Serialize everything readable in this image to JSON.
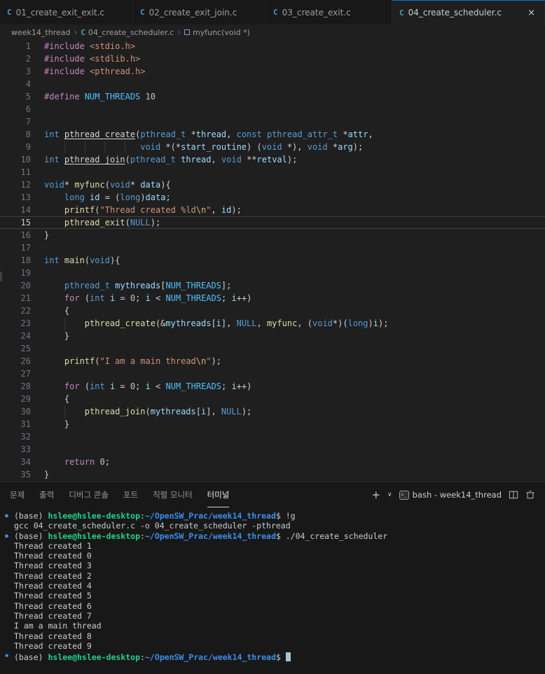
{
  "tabs": [
    {
      "label": "01_create_exit_exit.c",
      "active": false
    },
    {
      "label": "02_create_exit_join.c",
      "active": false
    },
    {
      "label": "03_create_exit.c",
      "active": false
    },
    {
      "label": "04_create_scheduler.c",
      "active": true
    }
  ],
  "tab_close_glyph": "×",
  "breadcrumb": {
    "root": "week14_thread",
    "file": "04_create_scheduler.c",
    "symbol": "myfunc(void *)",
    "separator": "›"
  },
  "editor": {
    "current_line": 15,
    "lines": [
      {
        "num": 1,
        "tokens": [
          [
            "kw",
            "#include"
          ],
          [
            "pl",
            " "
          ],
          [
            "str",
            "<stdio.h>"
          ]
        ]
      },
      {
        "num": 2,
        "tokens": [
          [
            "kw",
            "#include"
          ],
          [
            "pl",
            " "
          ],
          [
            "str",
            "<stdlib.h>"
          ]
        ]
      },
      {
        "num": 3,
        "tokens": [
          [
            "kw",
            "#include"
          ],
          [
            "pl",
            " "
          ],
          [
            "str",
            "<pthread.h>"
          ]
        ]
      },
      {
        "num": 4,
        "tokens": []
      },
      {
        "num": 5,
        "tokens": [
          [
            "kw",
            "#define"
          ],
          [
            "pl",
            " "
          ],
          [
            "mac",
            "NUM_THREADS"
          ],
          [
            "pl",
            " "
          ],
          [
            "num",
            "10"
          ]
        ]
      },
      {
        "num": 6,
        "tokens": []
      },
      {
        "num": 7,
        "tokens": []
      },
      {
        "num": 8,
        "tokens": [
          [
            "ty",
            "int"
          ],
          [
            "pl",
            " "
          ],
          [
            "fnu",
            "pthread_create"
          ],
          [
            "pl",
            "("
          ],
          [
            "ty",
            "pthread_t"
          ],
          [
            "pl",
            " *"
          ],
          [
            "var",
            "thread"
          ],
          [
            "pl",
            ", "
          ],
          [
            "ty",
            "const"
          ],
          [
            "pl",
            " "
          ],
          [
            "ty",
            "pthread_attr_t"
          ],
          [
            "pl",
            " *"
          ],
          [
            "var",
            "attr"
          ],
          [
            "pl",
            ","
          ]
        ]
      },
      {
        "num": 9,
        "guides": [
          4,
          8,
          12,
          16
        ],
        "tokens": [
          [
            "pl",
            "                   "
          ],
          [
            "ty",
            "void"
          ],
          [
            "pl",
            " *(*"
          ],
          [
            "var",
            "start_routine"
          ],
          [
            "pl",
            ") ("
          ],
          [
            "ty",
            "void"
          ],
          [
            "pl",
            " *), "
          ],
          [
            "ty",
            "void"
          ],
          [
            "pl",
            " *"
          ],
          [
            "var",
            "arg"
          ],
          [
            "pl",
            ");"
          ]
        ]
      },
      {
        "num": 10,
        "tokens": [
          [
            "ty",
            "int"
          ],
          [
            "pl",
            " "
          ],
          [
            "fnu",
            "pthread_join"
          ],
          [
            "pl",
            "("
          ],
          [
            "ty",
            "pthread_t"
          ],
          [
            "pl",
            " "
          ],
          [
            "var",
            "thread"
          ],
          [
            "pl",
            ", "
          ],
          [
            "ty",
            "void"
          ],
          [
            "pl",
            " **"
          ],
          [
            "var",
            "retval"
          ],
          [
            "pl",
            ");"
          ]
        ]
      },
      {
        "num": 11,
        "tokens": []
      },
      {
        "num": 12,
        "tokens": [
          [
            "ty",
            "void"
          ],
          [
            "pl",
            "* "
          ],
          [
            "fn",
            "myfunc"
          ],
          [
            "pl",
            "("
          ],
          [
            "ty",
            "void"
          ],
          [
            "pl",
            "* "
          ],
          [
            "var",
            "data"
          ],
          [
            "pl",
            "){"
          ]
        ]
      },
      {
        "num": 13,
        "tokens": [
          [
            "pl",
            "    "
          ],
          [
            "ty",
            "long"
          ],
          [
            "pl",
            " "
          ],
          [
            "var",
            "id"
          ],
          [
            "pl",
            " = ("
          ],
          [
            "ty",
            "long"
          ],
          [
            "pl",
            ")"
          ],
          [
            "var",
            "data"
          ],
          [
            "pl",
            ";"
          ]
        ]
      },
      {
        "num": 14,
        "tokens": [
          [
            "pl",
            "    "
          ],
          [
            "fn",
            "printf"
          ],
          [
            "pl",
            "("
          ],
          [
            "str",
            "\"Thread created %ld"
          ],
          [
            "esc",
            "\\n"
          ],
          [
            "str",
            "\""
          ],
          [
            "pl",
            ", "
          ],
          [
            "var",
            "id"
          ],
          [
            "pl",
            ");"
          ]
        ]
      },
      {
        "num": 15,
        "tokens": [
          [
            "pl",
            "    "
          ],
          [
            "fn",
            "pthread_exit"
          ],
          [
            "pl",
            "("
          ],
          [
            "ty",
            "NULL"
          ],
          [
            "pl",
            ");"
          ]
        ]
      },
      {
        "num": 16,
        "tokens": [
          [
            "pl",
            "}"
          ]
        ]
      },
      {
        "num": 17,
        "tokens": []
      },
      {
        "num": 18,
        "tokens": [
          [
            "ty",
            "int"
          ],
          [
            "pl",
            " "
          ],
          [
            "fn",
            "main"
          ],
          [
            "pl",
            "("
          ],
          [
            "ty",
            "void"
          ],
          [
            "pl",
            "){"
          ]
        ]
      },
      {
        "num": 19,
        "tokens": []
      },
      {
        "num": 20,
        "tokens": [
          [
            "pl",
            "    "
          ],
          [
            "ty",
            "pthread_t"
          ],
          [
            "pl",
            " "
          ],
          [
            "var",
            "mythreads"
          ],
          [
            "pl",
            "["
          ],
          [
            "mac",
            "NUM_THREADS"
          ],
          [
            "pl",
            "];"
          ]
        ]
      },
      {
        "num": 21,
        "tokens": [
          [
            "pl",
            "    "
          ],
          [
            "kw",
            "for"
          ],
          [
            "pl",
            " ("
          ],
          [
            "ty",
            "int"
          ],
          [
            "pl",
            " "
          ],
          [
            "var",
            "i"
          ],
          [
            "pl",
            " = "
          ],
          [
            "num",
            "0"
          ],
          [
            "pl",
            "; "
          ],
          [
            "var",
            "i"
          ],
          [
            "pl",
            " < "
          ],
          [
            "mac",
            "NUM_THREADS"
          ],
          [
            "pl",
            "; "
          ],
          [
            "var",
            "i"
          ],
          [
            "pl",
            "++)"
          ]
        ]
      },
      {
        "num": 22,
        "tokens": [
          [
            "pl",
            "    {"
          ]
        ]
      },
      {
        "num": 23,
        "guides": [
          4
        ],
        "tokens": [
          [
            "pl",
            "        "
          ],
          [
            "fn",
            "pthread_create"
          ],
          [
            "pl",
            "(&"
          ],
          [
            "var",
            "mythreads"
          ],
          [
            "pl",
            "["
          ],
          [
            "var",
            "i"
          ],
          [
            "pl",
            "], "
          ],
          [
            "ty",
            "NULL"
          ],
          [
            "pl",
            ", "
          ],
          [
            "fn",
            "myfunc"
          ],
          [
            "pl",
            ", ("
          ],
          [
            "ty",
            "void"
          ],
          [
            "pl",
            "*)("
          ],
          [
            "ty",
            "long"
          ],
          [
            "pl",
            ")"
          ],
          [
            "var",
            "i"
          ],
          [
            "pl",
            ");"
          ]
        ]
      },
      {
        "num": 24,
        "tokens": [
          [
            "pl",
            "    }"
          ]
        ]
      },
      {
        "num": 25,
        "tokens": []
      },
      {
        "num": 26,
        "tokens": [
          [
            "pl",
            "    "
          ],
          [
            "fn",
            "printf"
          ],
          [
            "pl",
            "("
          ],
          [
            "str",
            "\"I am a main thread"
          ],
          [
            "esc",
            "\\n"
          ],
          [
            "str",
            "\""
          ],
          [
            "pl",
            ");"
          ]
        ]
      },
      {
        "num": 27,
        "tokens": []
      },
      {
        "num": 28,
        "tokens": [
          [
            "pl",
            "    "
          ],
          [
            "kw",
            "for"
          ],
          [
            "pl",
            " ("
          ],
          [
            "ty",
            "int"
          ],
          [
            "pl",
            " "
          ],
          [
            "var",
            "i"
          ],
          [
            "pl",
            " = "
          ],
          [
            "num",
            "0"
          ],
          [
            "pl",
            "; "
          ],
          [
            "var",
            "i"
          ],
          [
            "pl",
            " < "
          ],
          [
            "mac",
            "NUM_THREADS"
          ],
          [
            "pl",
            "; "
          ],
          [
            "var",
            "i"
          ],
          [
            "pl",
            "++)"
          ]
        ]
      },
      {
        "num": 29,
        "tokens": [
          [
            "pl",
            "    {"
          ]
        ]
      },
      {
        "num": 30,
        "guides": [
          4
        ],
        "tokens": [
          [
            "pl",
            "        "
          ],
          [
            "fn",
            "pthread_join"
          ],
          [
            "pl",
            "("
          ],
          [
            "var",
            "mythreads"
          ],
          [
            "pl",
            "["
          ],
          [
            "var",
            "i"
          ],
          [
            "pl",
            "], "
          ],
          [
            "ty",
            "NULL"
          ],
          [
            "pl",
            ");"
          ]
        ]
      },
      {
        "num": 31,
        "tokens": [
          [
            "pl",
            "    }"
          ]
        ]
      },
      {
        "num": 32,
        "tokens": []
      },
      {
        "num": 33,
        "tokens": []
      },
      {
        "num": 34,
        "tokens": [
          [
            "pl",
            "    "
          ],
          [
            "kw",
            "return"
          ],
          [
            "pl",
            " "
          ],
          [
            "num",
            "0"
          ],
          [
            "pl",
            ";"
          ]
        ]
      },
      {
        "num": 35,
        "tokens": [
          [
            "pl",
            "}"
          ]
        ]
      }
    ]
  },
  "panel": {
    "tabs": [
      {
        "label": "문제",
        "active": false
      },
      {
        "label": "출력",
        "active": false
      },
      {
        "label": "디버그 콘솔",
        "active": false
      },
      {
        "label": "포트",
        "active": false
      },
      {
        "label": "직렬 모니터",
        "active": false
      },
      {
        "label": "터미널",
        "active": true
      }
    ],
    "plus_glyph": "+",
    "chevron_glyph": "∨",
    "terminal_session_label": "bash - week14_thread"
  },
  "terminal": {
    "lines": [
      {
        "g": "●",
        "t": [
          [
            "pl",
            "(base) "
          ],
          [
            "user",
            "hslee@hslee-desktop"
          ],
          [
            "pl",
            ":"
          ],
          [
            "path",
            "~/OpenSW_Prac/week14_thread"
          ],
          [
            "pl",
            "$ !g"
          ]
        ]
      },
      {
        "g": "",
        "t": [
          [
            "pl",
            "gcc 04_create_scheduler.c -o 04_create_scheduler -pthread"
          ]
        ]
      },
      {
        "g": "●",
        "t": [
          [
            "pl",
            "(base) "
          ],
          [
            "user",
            "hslee@hslee-desktop"
          ],
          [
            "pl",
            ":"
          ],
          [
            "path",
            "~/OpenSW_Prac/week14_thread"
          ],
          [
            "pl",
            "$ ./04_create_scheduler"
          ]
        ]
      },
      {
        "g": "",
        "t": [
          [
            "pl",
            "Thread created 1"
          ]
        ]
      },
      {
        "g": "",
        "t": [
          [
            "pl",
            "Thread created 0"
          ]
        ]
      },
      {
        "g": "",
        "t": [
          [
            "pl",
            "Thread created 3"
          ]
        ]
      },
      {
        "g": "",
        "t": [
          [
            "pl",
            "Thread created 2"
          ]
        ]
      },
      {
        "g": "",
        "t": [
          [
            "pl",
            "Thread created 4"
          ]
        ]
      },
      {
        "g": "",
        "t": [
          [
            "pl",
            "Thread created 5"
          ]
        ]
      },
      {
        "g": "",
        "t": [
          [
            "pl",
            "Thread created 6"
          ]
        ]
      },
      {
        "g": "",
        "t": [
          [
            "pl",
            "Thread created 7"
          ]
        ]
      },
      {
        "g": "",
        "t": [
          [
            "pl",
            "I am a main thread"
          ]
        ]
      },
      {
        "g": "",
        "t": [
          [
            "pl",
            "Thread created 8"
          ]
        ]
      },
      {
        "g": "",
        "t": [
          [
            "pl",
            "Thread created 9"
          ]
        ]
      },
      {
        "g": "◆",
        "t": [
          [
            "pl",
            "(base) "
          ],
          [
            "user",
            "hslee@hslee-desktop"
          ],
          [
            "pl",
            ":"
          ],
          [
            "path",
            "~/OpenSW_Prac/week14_thread"
          ],
          [
            "pl",
            "$ "
          ],
          [
            "cursor",
            ""
          ]
        ]
      }
    ]
  },
  "colors": {
    "active_tab_accent": "#0078d4",
    "c_file_icon": "#519aba",
    "command_decoration_blue": "#3794ff",
    "prompt_user_green": "#23d18b",
    "prompt_path_blue": "#3b8eea",
    "keyword_pink": "#C586C0",
    "type_blue": "#569CD6",
    "function_yellow": "#DCDCAA",
    "string_orange": "#CE9178"
  }
}
